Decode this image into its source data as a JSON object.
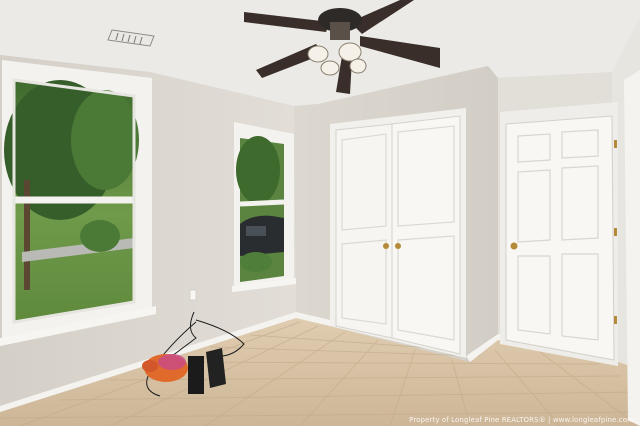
{
  "photo": {
    "subject": "empty bedroom with ceiling fan, two windows, double closet door and single door",
    "watermark": "Property of Longleaf Pine REALTORS® | www.longleafpine.com"
  },
  "colors": {
    "wall": "#dcd8d1",
    "ceiling": "#ecebe7",
    "trim": "#f4f3ef",
    "floor_tile": "#d7c3a6",
    "fan_blade": "#3a2e2a",
    "foliage": "#4f7a3a"
  }
}
